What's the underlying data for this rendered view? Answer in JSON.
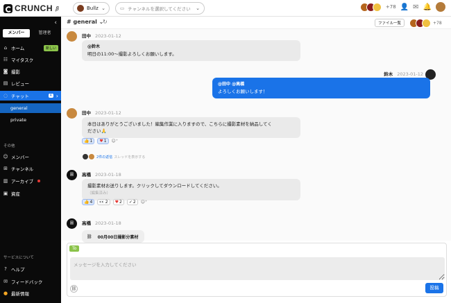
{
  "header": {
    "logo_text": "CRUNCH",
    "logo_beta": "β",
    "workspace": "Bullz",
    "channel_placeholder": "チャンネルを選択してください",
    "member_extra": "+78"
  },
  "sidebar": {
    "roles": [
      "メンバー",
      "管理者"
    ],
    "nav": [
      {
        "label": "ホーム",
        "badge": "新しい"
      },
      {
        "label": "マイタスク"
      },
      {
        "label": "撮影"
      },
      {
        "label": "レビュー"
      },
      {
        "label": "チャット",
        "count": "4"
      }
    ],
    "channels": [
      "general",
      "private"
    ],
    "section_other": "その他",
    "other_items": [
      "メンバー",
      "チャンネル",
      "アーカイブ",
      "資産"
    ],
    "section_service": "サービスについて",
    "service_items": [
      "ヘルプ",
      "フィードバック",
      "最新情報"
    ]
  },
  "channel": {
    "name": "# general",
    "files_button": "ファイル一覧",
    "member_extra": "+78"
  },
  "messages": [
    {
      "name": "田中",
      "date": "2023-01-12",
      "mention": "@鈴木",
      "text": "明日の11:00〜撮影よろしくお願いします。"
    },
    {
      "name": "鈴木",
      "date": "2023-01-12",
      "mention": "@田中 @高橋",
      "text": "よろしくお願いします！"
    },
    {
      "name": "田中",
      "date": "2023-01-12",
      "text1": "本日はありがとうございました！編集作業に入りますので、こちらに撮影素材を納品してく",
      "text2": "ださい🙏",
      "r1": "1",
      "r2": "1",
      "replies": "2件の返信",
      "replies_hint": "スレッドを表示する"
    },
    {
      "name": "高橋",
      "date": "2023-01-18",
      "text": "撮影素材お送りします。クリックしてダウンロードしてください。",
      "edited": "（編集済み）",
      "r1": "4",
      "r2": "2",
      "r3": "2",
      "r4": "2"
    },
    {
      "name": "高橋",
      "date": "2023-01-18",
      "file": "00月00日撮影分素材"
    }
  ],
  "composer": {
    "to_label": "To",
    "placeholder": "メッセージを入力してください",
    "send": "投稿"
  },
  "colors": {
    "accent": "#1a73e8",
    "sidebar": "#0a0a0a",
    "new_badge": "#8bc34a"
  }
}
